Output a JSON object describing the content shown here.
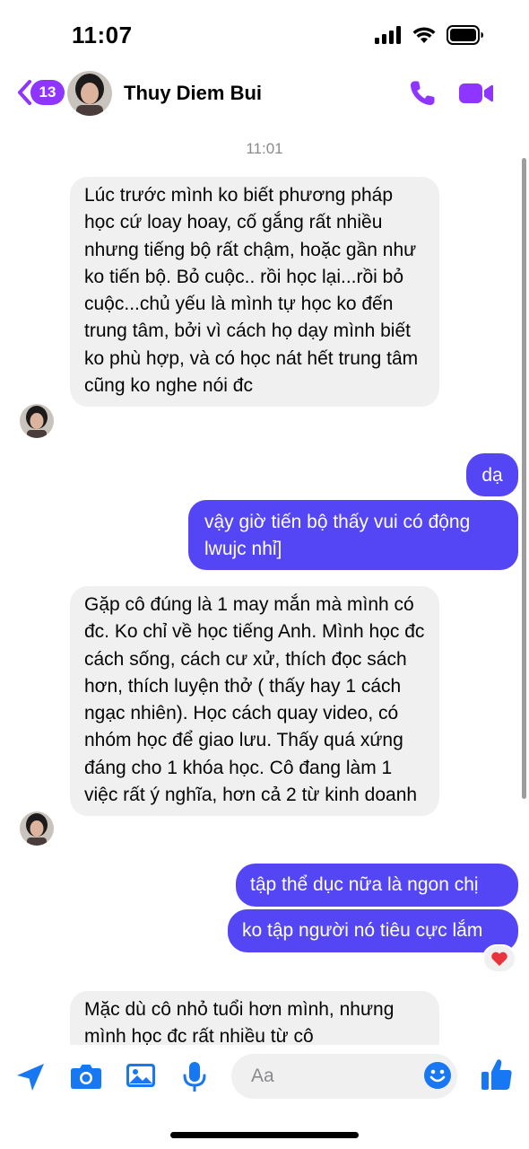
{
  "status_bar": {
    "time": "11:07"
  },
  "header": {
    "back_badge_count": "13",
    "contact_name": "Thuy Diem Bui"
  },
  "conversation": {
    "timestamp": "11:01",
    "messages": [
      {
        "from": "contact",
        "text": "Lúc trước mình ko biết phương pháp học cứ loay hoay, cố gắng rất nhiều nhưng tiếng bộ rất chậm, hoặc gần như ko tiến bộ. Bỏ cuộc.. rồi học lại...rồi bỏ cuộc...chủ yếu là mình tự học ko đến trung tâm, bởi vì cách họ dạy mình biết ko phù hợp, và có học nát hết trung tâm cũng ko nghe nói đc"
      },
      {
        "from": "me",
        "text": "dạ"
      },
      {
        "from": "me",
        "text": "vậy giờ tiến bộ thấy vui có động lwujc nhỉ]"
      },
      {
        "from": "contact",
        "text": "Gặp cô đúng là 1 may mắn mà mình có đc. Ko chỉ về học tiếng Anh. Mình học đc cách sống, cách cư xử, thích đọc sách hơn, thích luyện thở ( thấy hay 1 cách ngạc nhiên). Học cách quay video, có nhóm học để giao lưu. Thấy quá xứng đáng cho 1 khóa học. Cô đang làm 1 việc rất ý nghĩa, hơn cả 2 từ kinh doanh"
      },
      {
        "from": "me",
        "text": "tập thể dục nữa là ngon chị"
      },
      {
        "from": "me",
        "text": "ko tập người nó tiêu cực lắm",
        "reaction": "heart"
      },
      {
        "from": "contact",
        "text": "Mặc dù cô nhỏ tuổi hơn mình, nhưng mình học đc rất nhiều từ cô"
      }
    ]
  },
  "composer": {
    "placeholder": "Aa"
  },
  "colors": {
    "accent": "#8e35ff",
    "outgoing_bubble": "#5546f5",
    "incoming_bubble": "#f0f0f0",
    "composer_icons": "#1877f2"
  }
}
